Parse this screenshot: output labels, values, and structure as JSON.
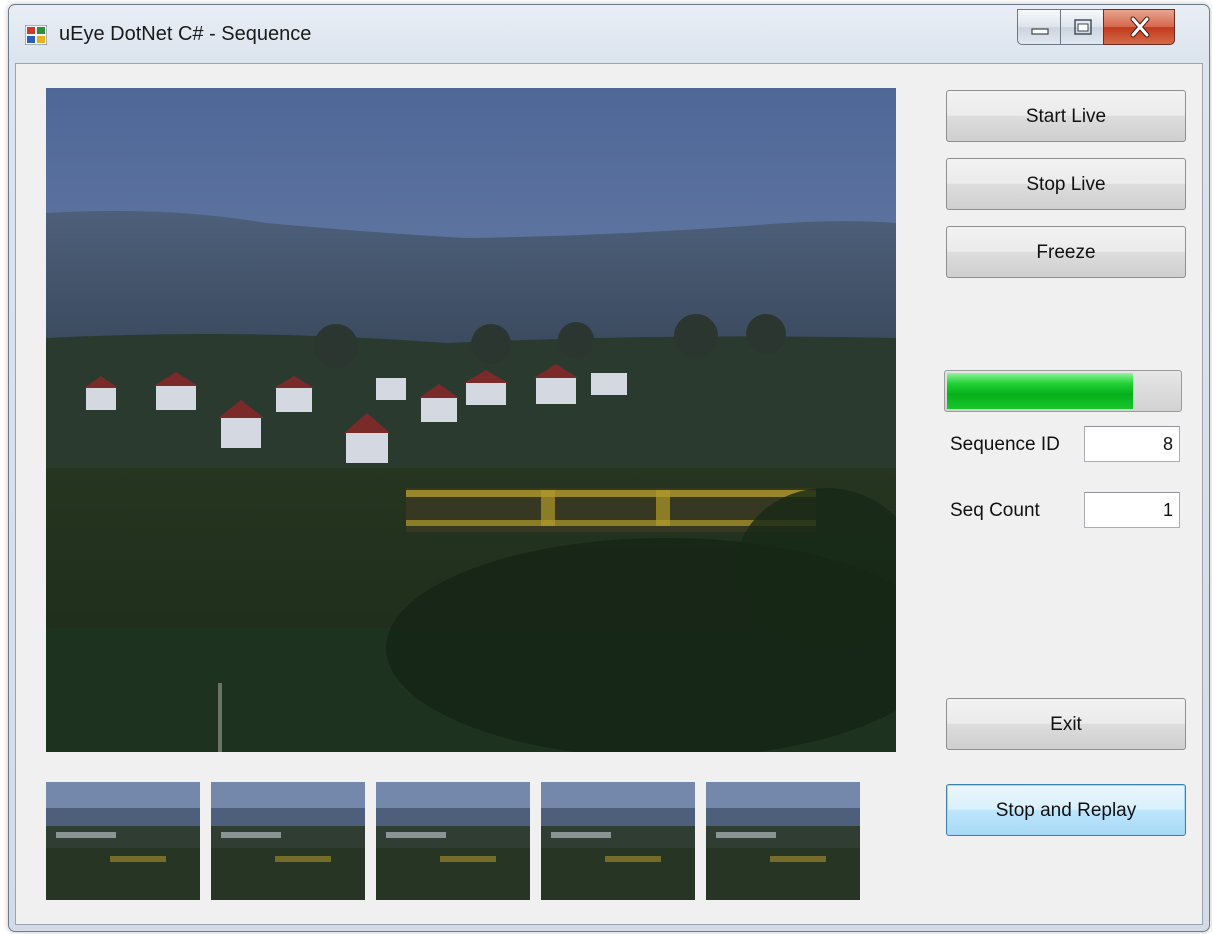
{
  "window": {
    "title": "uEye DotNet C# - Sequence"
  },
  "buttons": {
    "start_live": "Start Live",
    "stop_live": "Stop Live",
    "freeze": "Freeze",
    "exit": "Exit",
    "stop_and_replay": "Stop and Replay"
  },
  "progress": {
    "fraction": 0.8
  },
  "fields": {
    "sequence_id_label": "Sequence ID",
    "sequence_id_value": "8",
    "seq_count_label": "Seq Count",
    "seq_count_value": "1"
  },
  "thumbnails": {
    "count": 5
  },
  "colors": {
    "progress_green": "#06b01c",
    "window_bg": "#f0f0f0",
    "close_red": "#c2391b"
  }
}
